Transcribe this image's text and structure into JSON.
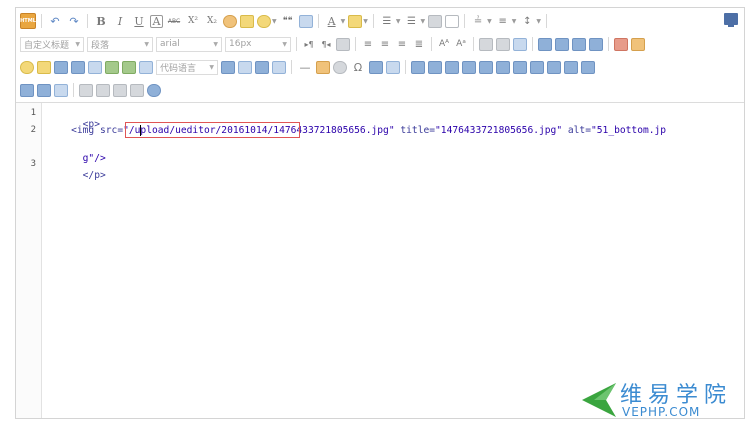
{
  "toolbar": {
    "html_label": "HTML",
    "style_select": "自定义标题",
    "paragraph_select": "段落",
    "font_select": "arial",
    "size_select": "16px",
    "code_lang_select": "代码语言",
    "bold": "B",
    "italic": "I",
    "underline": "U",
    "fontborder": "A",
    "strike": "ABC",
    "sup": "X²",
    "sub": "X₂",
    "quote": "❝❝",
    "fontcolor": "A",
    "rowspacing": "A"
  },
  "code": {
    "line_numbers": [
      "1",
      "2",
      "3"
    ],
    "line1": "<p>",
    "line2_indent": "    ",
    "line2_tag_open": "<img ",
    "line2_attr_src": "src=",
    "line2_src_value_highlighted": "\"/upload/ueditor/20161014/",
    "line2_src_value_rest": "1476433721805656.jpg\"",
    "line2_attr_title": " title=",
    "line2_title_value": "\"1476433721805656.jpg\"",
    "line2_attr_alt": " alt=",
    "line2_alt_value_a": "\"51_bottom.jp",
    "line2_wrap": "g\"/>",
    "line3": "</p>"
  },
  "watermark": {
    "chinese": "维易学院",
    "domain": "VEPHP.COM"
  },
  "colors": {
    "highlight_border": "#e05555",
    "watermark_blue": "#3b8bd1",
    "watermark_green": "#3aa53f",
    "html_button": "#e9a640"
  }
}
